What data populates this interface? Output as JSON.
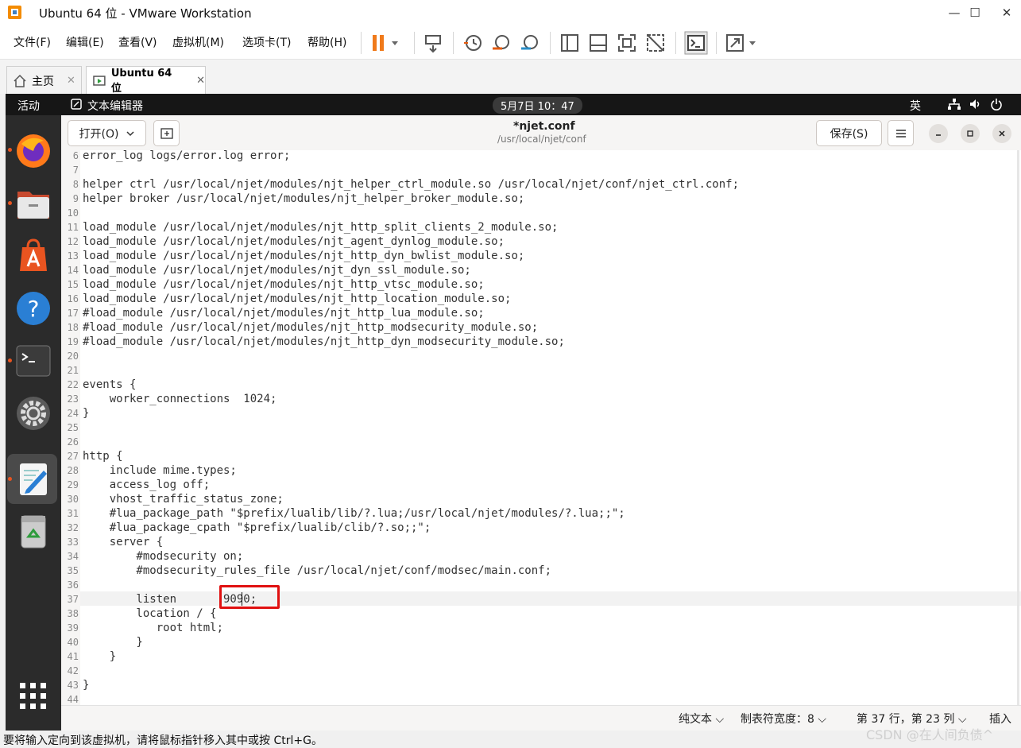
{
  "window": {
    "title": "Ubuntu 64 位 - VMware Workstation",
    "minimize": "—",
    "maximize": "☐",
    "close": "✕"
  },
  "menubar": {
    "items": [
      "文件(F)",
      "编辑(E)",
      "查看(V)",
      "虚拟机(M)",
      "选项卡(T)",
      "帮助(H)"
    ]
  },
  "tabs": [
    {
      "label": "主页",
      "close": "✕"
    },
    {
      "label": "Ubuntu 64 位",
      "close": "✕"
    }
  ],
  "topbar": {
    "activities": "活动",
    "app": "文本编辑器",
    "datetime": "5月7日 10：47",
    "input_method": "英"
  },
  "dock": [
    "firefox-icon",
    "files-icon",
    "software-icon",
    "help-icon",
    "terminal-icon",
    "settings-icon",
    "text-editor-icon",
    "trash-icon",
    "app-grid-icon"
  ],
  "header": {
    "open_label": "打开(O)",
    "doc_title": "*njet.conf",
    "doc_path": "/usr/local/njet/conf",
    "save_label": "保存(S)"
  },
  "editor": {
    "lines": [
      {
        "n": "6",
        "t": "error_log logs/error.log error;"
      },
      {
        "n": "7",
        "t": ""
      },
      {
        "n": "8",
        "t": "helper ctrl /usr/local/njet/modules/njt_helper_ctrl_module.so /usr/local/njet/conf/njet_ctrl.conf;"
      },
      {
        "n": "9",
        "t": "helper broker /usr/local/njet/modules/njt_helper_broker_module.so;"
      },
      {
        "n": "10",
        "t": ""
      },
      {
        "n": "11",
        "t": "load_module /usr/local/njet/modules/njt_http_split_clients_2_module.so;"
      },
      {
        "n": "12",
        "t": "load_module /usr/local/njet/modules/njt_agent_dynlog_module.so;"
      },
      {
        "n": "13",
        "t": "load_module /usr/local/njet/modules/njt_http_dyn_bwlist_module.so;"
      },
      {
        "n": "14",
        "t": "load_module /usr/local/njet/modules/njt_dyn_ssl_module.so;"
      },
      {
        "n": "15",
        "t": "load_module /usr/local/njet/modules/njt_http_vtsc_module.so;"
      },
      {
        "n": "16",
        "t": "load_module /usr/local/njet/modules/njt_http_location_module.so;"
      },
      {
        "n": "17",
        "t": "#load_module /usr/local/njet/modules/njt_http_lua_module.so;"
      },
      {
        "n": "18",
        "t": "#load_module /usr/local/njet/modules/njt_http_modsecurity_module.so;"
      },
      {
        "n": "19",
        "t": "#load_module /usr/local/njet/modules/njt_http_dyn_modsecurity_module.so;"
      },
      {
        "n": "20",
        "t": ""
      },
      {
        "n": "21",
        "t": ""
      },
      {
        "n": "22",
        "t": "events {"
      },
      {
        "n": "23",
        "t": "    worker_connections  1024;"
      },
      {
        "n": "24",
        "t": "}"
      },
      {
        "n": "25",
        "t": ""
      },
      {
        "n": "26",
        "t": ""
      },
      {
        "n": "27",
        "t": "http {"
      },
      {
        "n": "28",
        "t": "    include mime.types;"
      },
      {
        "n": "29",
        "t": "    access_log off;"
      },
      {
        "n": "30",
        "t": "    vhost_traffic_status_zone;"
      },
      {
        "n": "31",
        "t": "    #lua_package_path \"$prefix/lualib/lib/?.lua;/usr/local/njet/modules/?.lua;;\";"
      },
      {
        "n": "32",
        "t": "    #lua_package_cpath \"$prefix/lualib/clib/?.so;;\";"
      },
      {
        "n": "33",
        "t": "    server {"
      },
      {
        "n": "34",
        "t": "        #modsecurity on;"
      },
      {
        "n": "35",
        "t": "        #modsecurity_rules_file /usr/local/njet/conf/modsec/main.conf;"
      },
      {
        "n": "36",
        "t": ""
      },
      {
        "n": "37",
        "t": "        listen       9090;"
      },
      {
        "n": "38",
        "t": "        location / {"
      },
      {
        "n": "39",
        "t": "           root html;"
      },
      {
        "n": "40",
        "t": "        }"
      },
      {
        "n": "41",
        "t": "    }"
      },
      {
        "n": "42",
        "t": ""
      },
      {
        "n": "43",
        "t": "}"
      },
      {
        "n": "44",
        "t": ""
      }
    ]
  },
  "status": {
    "syntax": "纯文本",
    "tab_width": "制表符宽度：8",
    "position": "第 37 行，第 23 列",
    "mode": "插入"
  },
  "hint": "要将输入定向到该虚拟机，请将鼠标指针移入其中或按 Ctrl+G。",
  "watermark": "CSDN @在人间负债^",
  "colors": {
    "highlight": "#e01010",
    "accent": "#e95420"
  }
}
